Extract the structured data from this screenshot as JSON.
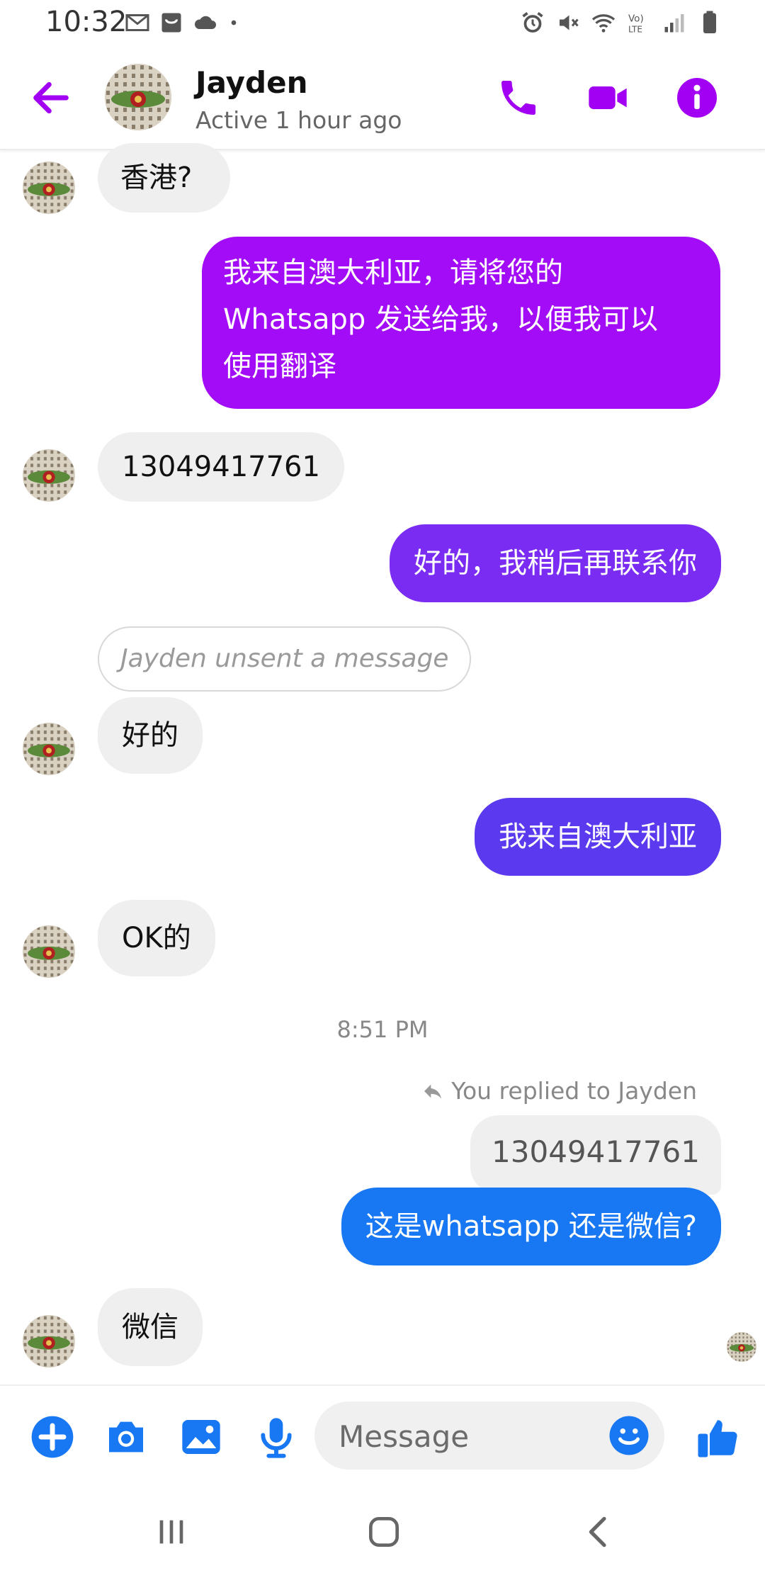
{
  "status_bar": {
    "time": "10:32",
    "left_icons": [
      "gmail-icon",
      "shopping-bag-icon",
      "cloud-icon",
      "dot-icon"
    ],
    "right_icons": [
      "alarm-icon",
      "mute-icon",
      "wifi-icon",
      "volte-icon",
      "signal-icon",
      "battery-icon"
    ]
  },
  "header": {
    "name": "Jayden",
    "status": "Active 1 hour ago",
    "accent_color": "#a100f2"
  },
  "messages": [
    {
      "side": "in",
      "text": "香港?"
    },
    {
      "side": "out",
      "lines": [
        "我来自澳大利亚，请将您的",
        "Whatsapp 发送给我，以便我可以",
        "使用翻译"
      ],
      "color": "#a20cf6"
    },
    {
      "side": "in",
      "text": "13049417761"
    },
    {
      "side": "out",
      "text": "好的，我稍后再联系你",
      "color": "#7a2cf3"
    },
    {
      "side": "unsent",
      "text": "Jayden unsent a message"
    },
    {
      "side": "in",
      "text": "好的"
    },
    {
      "side": "out",
      "text": "我来自澳大利亚",
      "color": "#5a39ee"
    },
    {
      "side": "in",
      "text": "OK的"
    },
    {
      "side": "timestamp",
      "text": "8:51 PM"
    },
    {
      "side": "reply_note",
      "text": "You replied to Jayden"
    },
    {
      "side": "quoted",
      "text": "13049417761"
    },
    {
      "side": "out",
      "text": "这是whatsapp 还是微信?",
      "color": "#1877f2"
    },
    {
      "side": "in",
      "text": "微信"
    }
  ],
  "composer": {
    "placeholder": "Message",
    "icon_color": "#1877f2"
  },
  "nav": {
    "buttons": [
      "recents-icon",
      "home-icon",
      "back-icon"
    ]
  }
}
